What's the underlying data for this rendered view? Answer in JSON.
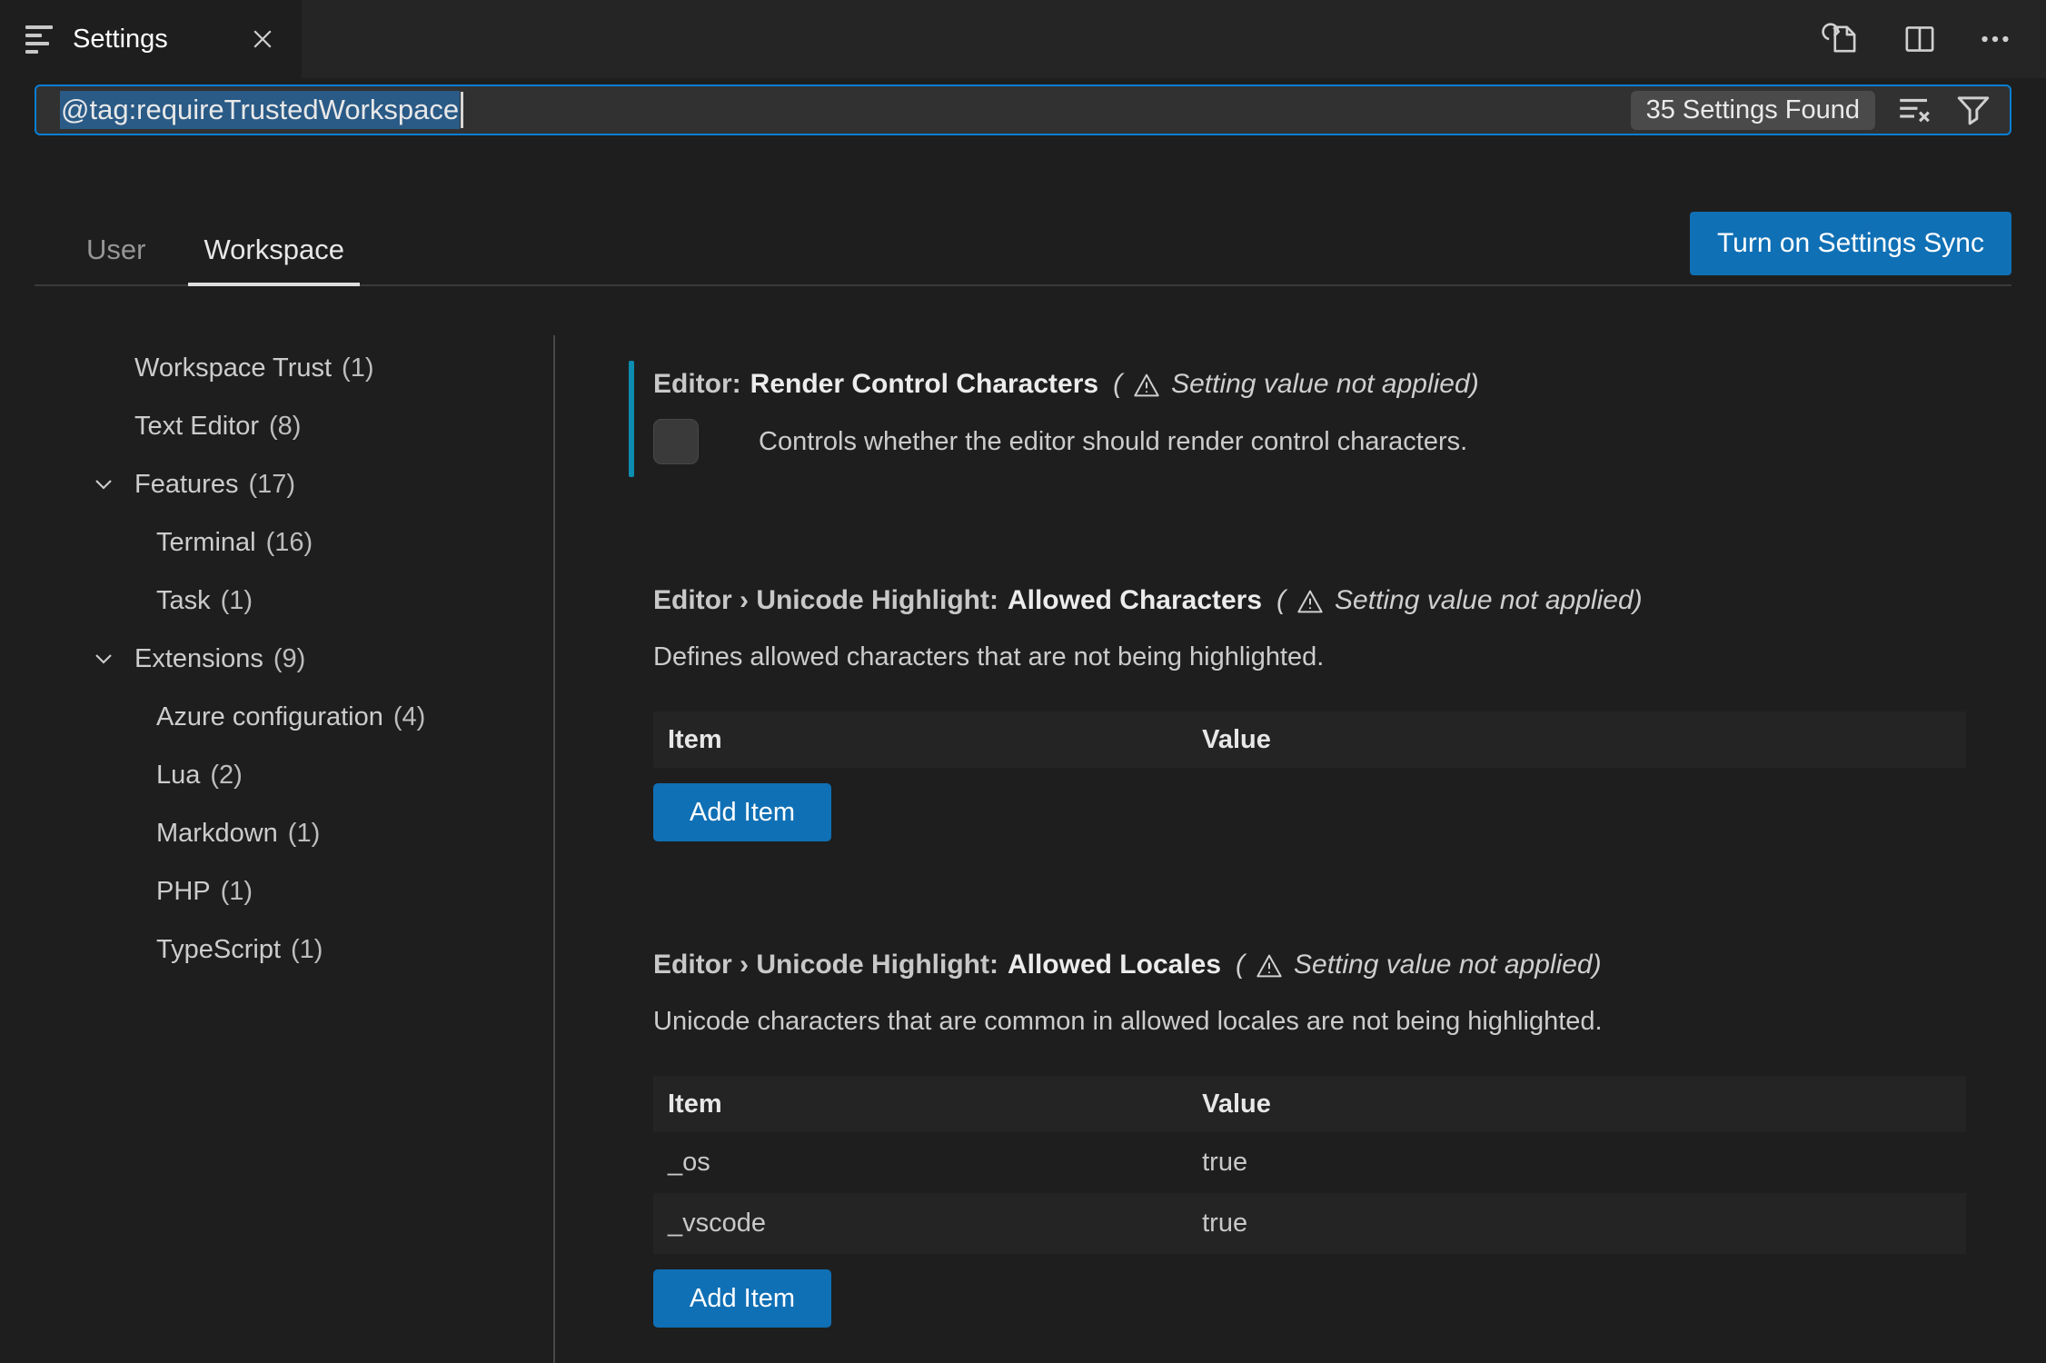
{
  "colors": {
    "accent_blue": "#1070b5",
    "focus_border": "#0a7fd4",
    "modified_indicator": "#0c8cb0",
    "selection": "#2a5a86",
    "tabstrip_bg": "#252526",
    "bg": "#1e1e1e"
  },
  "ui": {
    "paren_open": "(",
    "paren_close": ")"
  },
  "tab": {
    "title": "Settings"
  },
  "icons": {
    "tab_icon": "settings-sliders",
    "tab_close": "close",
    "editor_actions": [
      "open-settings-json",
      "split-editor",
      "more-actions"
    ],
    "search_icons": [
      "clear-search-results",
      "filter"
    ],
    "toc_icon": "chevron-down",
    "annotation_icon": "warning-triangle"
  },
  "search": {
    "value": "@tag:requireTrustedWorkspace",
    "results_label": "35 Settings Found"
  },
  "scope": {
    "tabs": [
      {
        "label": "User",
        "active": false
      },
      {
        "label": "Workspace",
        "active": true
      }
    ],
    "sync_button": "Turn on Settings Sync"
  },
  "toc": [
    {
      "label": "Workspace Trust",
      "count": "(1)",
      "level": 1,
      "chevron": false
    },
    {
      "label": "Text Editor",
      "count": "(8)",
      "level": 1,
      "chevron": false
    },
    {
      "label": "Features",
      "count": "(17)",
      "level": 1,
      "chevron": true
    },
    {
      "label": "Terminal",
      "count": "(16)",
      "level": 2,
      "chevron": false
    },
    {
      "label": "Task",
      "count": "(1)",
      "level": 2,
      "chevron": false
    },
    {
      "label": "Extensions",
      "count": "(9)",
      "level": 1,
      "chevron": true
    },
    {
      "label": "Azure configuration",
      "count": "(4)",
      "level": 2,
      "chevron": false
    },
    {
      "label": "Lua",
      "count": "(2)",
      "level": 2,
      "chevron": false
    },
    {
      "label": "Markdown",
      "count": "(1)",
      "level": 2,
      "chevron": false
    },
    {
      "label": "PHP",
      "count": "(1)",
      "level": 2,
      "chevron": false
    },
    {
      "label": "TypeScript",
      "count": "(1)",
      "level": 2,
      "chevron": false
    }
  ],
  "settings": [
    {
      "prefix": "Editor:",
      "name": "Render Control Characters",
      "annotation": "Setting value not applied",
      "description": "Controls whether the editor should render control characters.",
      "type": "checkbox",
      "checked": false,
      "modified": true
    },
    {
      "prefix": "Editor › Unicode Highlight:",
      "name": "Allowed Characters",
      "annotation": "Setting value not applied",
      "description": "Defines allowed characters that are not being highlighted.",
      "type": "table",
      "table": {
        "headers": {
          "item": "Item",
          "value": "Value"
        },
        "rows": []
      },
      "add_button": "Add Item"
    },
    {
      "prefix": "Editor › Unicode Highlight:",
      "name": "Allowed Locales",
      "annotation": "Setting value not applied",
      "description": "Unicode characters that are common in allowed locales are not being highlighted.",
      "type": "table",
      "table": {
        "headers": {
          "item": "Item",
          "value": "Value"
        },
        "rows": [
          {
            "item": "_os",
            "value": "true"
          },
          {
            "item": "_vscode",
            "value": "true"
          }
        ]
      },
      "add_button": "Add Item"
    }
  ]
}
